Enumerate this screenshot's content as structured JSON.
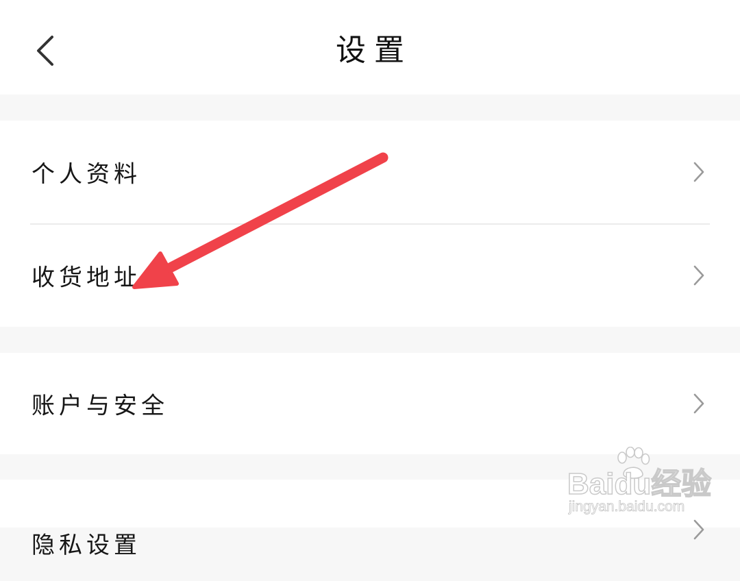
{
  "header": {
    "title": "设置",
    "back_icon": "chevron-left-icon"
  },
  "groups": [
    {
      "items": [
        {
          "label": "个人资料",
          "icon": "chevron-right-icon"
        },
        {
          "label": "收货地址",
          "icon": "chevron-right-icon"
        }
      ]
    },
    {
      "items": [
        {
          "label": "账户与安全",
          "icon": "chevron-right-icon"
        }
      ]
    },
    {
      "items": [
        {
          "label": "隐私设置",
          "icon": "chevron-right-icon"
        }
      ]
    }
  ],
  "annotation": {
    "type": "arrow",
    "color": "#f0424a",
    "points_to": "收货地址"
  },
  "watermark": {
    "logo": "Baidu经验",
    "url": "jingyan.baidu.com"
  },
  "colors": {
    "background": "#f7f7f7",
    "surface": "#ffffff",
    "divider": "#ebebeb",
    "chevron": "#9a9a9a",
    "text": "#161616"
  }
}
